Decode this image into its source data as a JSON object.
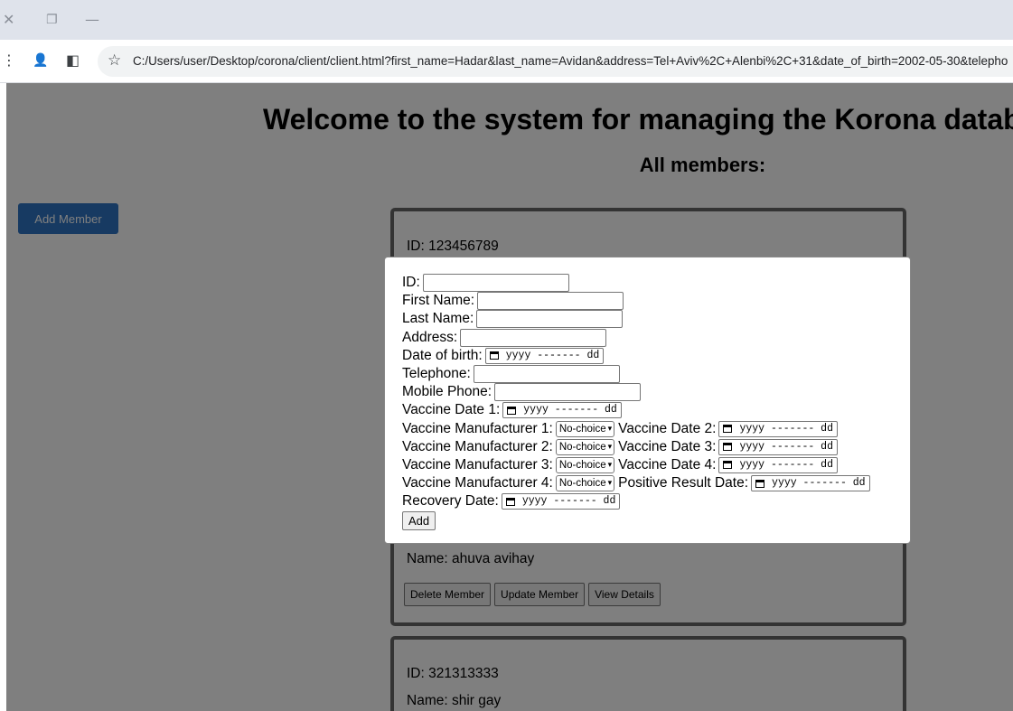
{
  "browser": {
    "close_glyph": "✕",
    "restore_glyph": "❐",
    "minimize_glyph": "—",
    "menu_glyph": "⋮",
    "profile_glyph": "👤",
    "sidebar_glyph": "◧",
    "star_glyph": "☆",
    "url": "C:/Users/user/Desktop/corona/client/client.html?first_name=Hadar&last_name=Avidan&address=Tel+Aviv%2C+Alenbi%2C+31&date_of_birth=2002-05-30&telepho"
  },
  "page": {
    "title": "Welcome to the system for managing the Korona database",
    "subtitle": "All members:",
    "add_member_label": "Add Member"
  },
  "members": [
    {
      "id_text": "ID: 123456789",
      "name_text": "Name: ahuva avihay"
    },
    {
      "id_text": "ID: 321313333",
      "name_text": "Name: shir gay"
    }
  ],
  "card_buttons": {
    "delete": "Delete Member",
    "update": "Update Member",
    "view": "View Details"
  },
  "form": {
    "id_label": "ID:",
    "first_name_label": "First Name:",
    "last_name_label": "Last Name:",
    "address_label": "Address:",
    "dob_label": "Date of birth:",
    "telephone_label": "Telephone:",
    "mobile_label": "Mobile Phone:",
    "vaccine_date_1_label": "Vaccine Date 1:",
    "vaccine_manufacturer_1_label": "Vaccine Manufacturer 1:",
    "vaccine_date_2_label": "Vaccine Date 2:",
    "vaccine_manufacturer_2_label": "Vaccine Manufacturer 2:",
    "vaccine_date_3_label": "Vaccine Date 3:",
    "vaccine_manufacturer_3_label": "Vaccine Manufacturer 3:",
    "vaccine_date_4_label": "Vaccine Date 4:",
    "vaccine_manufacturer_4_label": "Vaccine Manufacturer 4:",
    "positive_result_label": "Positive Result Date:",
    "recovery_label": "Recovery Date:",
    "date_placeholder": "yyyy ------- dd",
    "select_value": "No-choice",
    "add_label": "Add"
  },
  "colors": {
    "accent": "#2e74c4",
    "overlay": "rgba(0,0,0,0.5)"
  }
}
